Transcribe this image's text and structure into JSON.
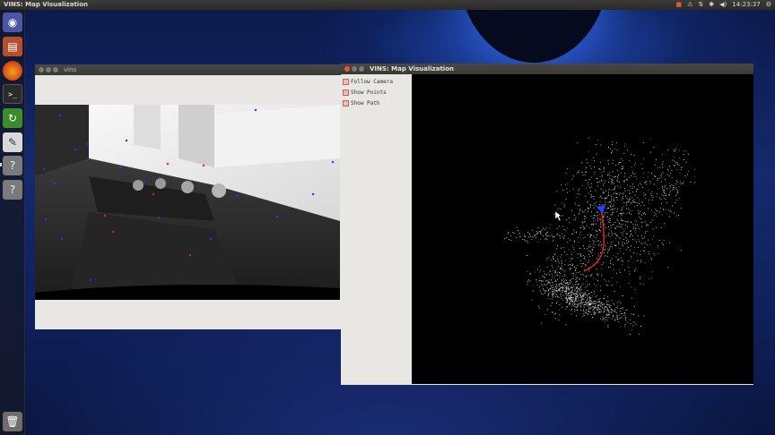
{
  "top_panel": {
    "title": "VINS: Map Visualization",
    "time": "14:23:37"
  },
  "launcher": {
    "items": [
      {
        "name": "dash",
        "icon": "ubuntu-logo-icon"
      },
      {
        "name": "files",
        "icon": "folder-icon"
      },
      {
        "name": "firefox",
        "icon": "firefox-icon"
      },
      {
        "name": "terminal",
        "icon": "terminal-icon"
      },
      {
        "name": "software-updater",
        "icon": "update-icon"
      },
      {
        "name": "text-editor",
        "icon": "text-editor-icon"
      },
      {
        "name": "unknown-app-1",
        "icon": "question-mark-icon"
      },
      {
        "name": "unknown-app-2",
        "icon": "question-mark-icon"
      },
      {
        "name": "trash",
        "icon": "trash-icon"
      }
    ]
  },
  "vins_window": {
    "title": "vins"
  },
  "map_window": {
    "title": "VINS: Map Visualization",
    "options": [
      {
        "label": "Follow Camera",
        "checked": false
      },
      {
        "label": "Show Points",
        "checked": false
      },
      {
        "label": "Show Path",
        "checked": false
      }
    ]
  },
  "colors": {
    "checkbox_fill": "#f2b8b8",
    "path": "#d42020",
    "camera_marker": "#2244ff",
    "feature_blue": "#3030ff",
    "feature_red": "#e02020"
  }
}
